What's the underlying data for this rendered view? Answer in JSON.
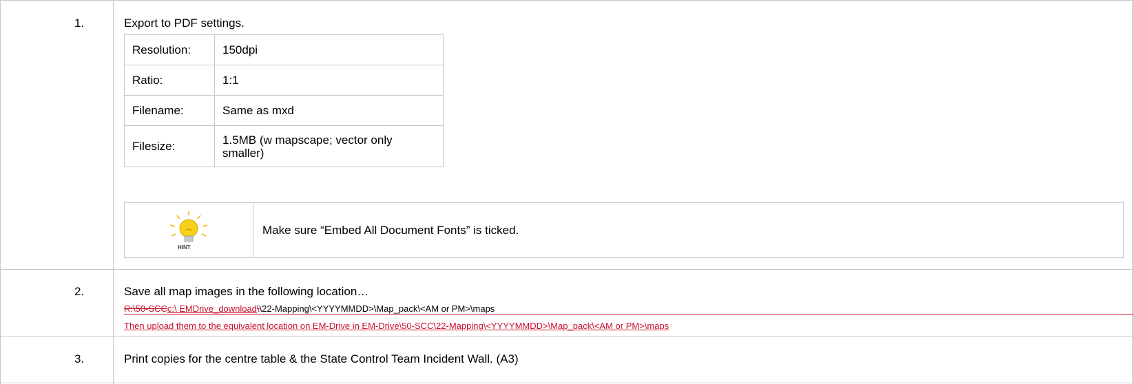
{
  "rows": [
    {
      "number": "1.",
      "text": "Export to PDF settings."
    },
    {
      "number": "2.",
      "text": "Save all map images in the following location…"
    },
    {
      "number": "3.",
      "text": "Print copies for the centre table & the State Control Team Incident Wall.  (A3)"
    }
  ],
  "settings": [
    {
      "key": "Resolution:",
      "value": "150dpi"
    },
    {
      "key": "Ratio:",
      "value": "1:1"
    },
    {
      "key": "Filename:",
      "value": "Same as mxd"
    },
    {
      "key": "Filesize:",
      "value": "1.5MB (w mapscape; vector only smaller)"
    }
  ],
  "hint": {
    "label": "HINT",
    "text": "Make sure “Embed All Document Fonts” is ticked."
  },
  "path": {
    "deleted": "R:\\50-SCC",
    "inserted": "c:\\ EMDrive_download",
    "deleted_sep": "\\",
    "rest": "\\22-Mapping\\<YYYYMMDD>\\Map_pack\\<AM or PM>\\maps"
  },
  "upload_note": "Then upload them to the equivalent location on EM-Drive in EM-Drive\\50-SCC\\22-Mapping\\<YYYYMMDD>\\Map_pack\\<AM or PM>\\maps",
  "colors": {
    "border": "#c8c8c8",
    "revision": "#c8102e",
    "bulb": "#f7d117"
  }
}
